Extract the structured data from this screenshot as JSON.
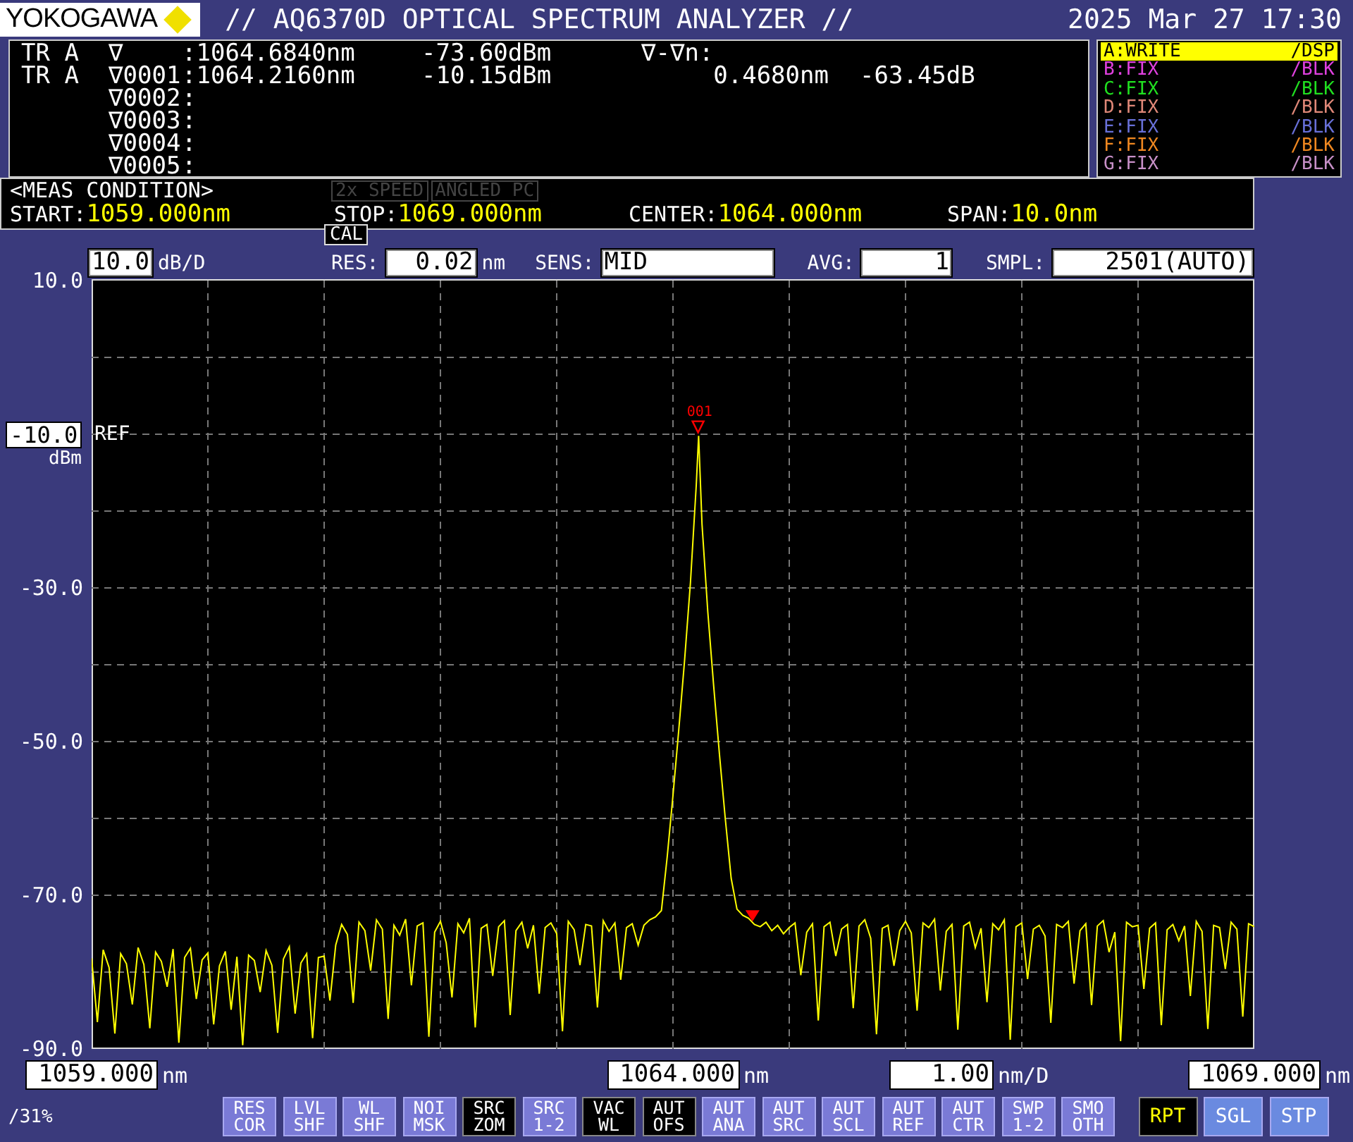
{
  "header": {
    "brand": "YOKOGAWA",
    "title": "// AQ6370D OPTICAL SPECTRUM ANALYZER //",
    "datetime": "2025 Mar 27 17:30"
  },
  "markers": {
    "rows": [
      {
        "trace": "TR A",
        "name": "∇",
        "value": ":1064.6840nm",
        "power": "-73.60dBm"
      },
      {
        "trace": "TR A",
        "name": "∇0001",
        "value": ":1064.2160nm",
        "power": "-10.15dBm"
      },
      {
        "name": "∇0002",
        "value": ":"
      },
      {
        "name": "∇0003",
        "value": ":"
      },
      {
        "name": "∇0004",
        "value": ":"
      },
      {
        "name": "∇0005",
        "value": ":"
      }
    ],
    "delta": {
      "label": "∇-∇n:",
      "wavelength": "0.4680nm",
      "power": "-63.45dB"
    }
  },
  "traces": [
    {
      "label": "A:WRITE",
      "mode": "/DSP",
      "color": "#ffff00",
      "selected": true
    },
    {
      "label": "B:FIX",
      "mode": "/BLK",
      "color": "#e040e0",
      "selected": false
    },
    {
      "label": "C:FIX",
      "mode": "/BLK",
      "color": "#20e020",
      "selected": false
    },
    {
      "label": "D:FIX",
      "mode": "/BLK",
      "color": "#e08878",
      "selected": false
    },
    {
      "label": "E:FIX",
      "mode": "/BLK",
      "color": "#6870d8",
      "selected": false
    },
    {
      "label": "F:FIX",
      "mode": "/BLK",
      "color": "#f08820",
      "selected": false
    },
    {
      "label": "G:FIX",
      "mode": "/BLK",
      "color": "#c890c8",
      "selected": false
    }
  ],
  "meas_condition": {
    "title": "<MEAS CONDITION>",
    "badges": [
      {
        "label": "2x SPEED",
        "on": false
      },
      {
        "label": "ANGLED PC",
        "on": false
      }
    ],
    "params": [
      {
        "label": "START:",
        "value": "1059.000nm"
      },
      {
        "label": "STOP:",
        "value": "1069.000nm"
      },
      {
        "label": "CENTER:",
        "value": "1064.000nm"
      },
      {
        "label": "SPAN:",
        "value": "10.0nm"
      }
    ]
  },
  "settings": {
    "scale": {
      "value": "10.0",
      "unit": "dB/D"
    },
    "cal": "CAL",
    "fields": [
      {
        "label": "RES:",
        "value": "0.02",
        "unit": "nm"
      },
      {
        "label": "SENS:",
        "value": "MID"
      },
      {
        "label": "AVG:",
        "value": "1"
      },
      {
        "label": "SMPL:",
        "value": "2501(AUTO)"
      }
    ]
  },
  "plot": {
    "ref": {
      "value": "-10.0",
      "unit": "dBm",
      "tag": "REF"
    },
    "peak_marker": "001",
    "chart_data": {
      "type": "line",
      "grid": true,
      "xlim": [
        1059,
        1069
      ],
      "ylim": [
        -90,
        10
      ],
      "yticks": [
        {
          "value": 10,
          "label": "10.0"
        },
        {
          "value": -30,
          "label": "-30.0"
        },
        {
          "value": -50,
          "label": "-50.0"
        },
        {
          "value": -70,
          "label": "-70.0"
        },
        {
          "value": -90,
          "label": "-90.0"
        }
      ],
      "xticks": [
        {
          "value": 1059,
          "label": "1059.000"
        },
        {
          "value": 1064,
          "label": "1064.000"
        },
        {
          "value": 1069,
          "label": "1069.000"
        }
      ],
      "x": [
        1059.0,
        1059.05,
        1059.1,
        1059.15,
        1059.2,
        1059.25,
        1059.3,
        1059.35,
        1059.4,
        1059.45,
        1059.5,
        1059.55,
        1059.6,
        1059.65,
        1059.7,
        1059.75,
        1059.8,
        1059.85,
        1059.9,
        1059.95,
        1060.0,
        1060.05,
        1060.1,
        1060.15,
        1060.2,
        1060.25,
        1060.3,
        1060.35,
        1060.4,
        1060.45,
        1060.5,
        1060.55,
        1060.6,
        1060.65,
        1060.7,
        1060.75,
        1060.8,
        1060.85,
        1060.9,
        1060.95,
        1061.0,
        1061.05,
        1061.1,
        1061.15,
        1061.2,
        1061.25,
        1061.3,
        1061.35,
        1061.4,
        1061.45,
        1061.5,
        1061.55,
        1061.6,
        1061.65,
        1061.7,
        1061.75,
        1061.8,
        1061.85,
        1061.9,
        1061.95,
        1062.0,
        1062.05,
        1062.1,
        1062.15,
        1062.2,
        1062.25,
        1062.3,
        1062.35,
        1062.4,
        1062.45,
        1062.5,
        1062.55,
        1062.6,
        1062.65,
        1062.7,
        1062.75,
        1062.8,
        1062.85,
        1062.9,
        1062.95,
        1063.0,
        1063.05,
        1063.1,
        1063.15,
        1063.2,
        1063.25,
        1063.3,
        1063.35,
        1063.4,
        1063.45,
        1063.5,
        1063.55,
        1063.6,
        1063.65,
        1063.7,
        1063.75,
        1063.8,
        1063.85,
        1063.9,
        1063.95,
        1064.0,
        1064.05,
        1064.1,
        1064.15,
        1064.2,
        1064.22,
        1064.25,
        1064.3,
        1064.35,
        1064.4,
        1064.45,
        1064.5,
        1064.55,
        1064.6,
        1064.65,
        1064.7,
        1064.75,
        1064.8,
        1064.85,
        1064.9,
        1064.95,
        1065.0,
        1065.05,
        1065.1,
        1065.15,
        1065.2,
        1065.25,
        1065.3,
        1065.35,
        1065.4,
        1065.45,
        1065.5,
        1065.55,
        1065.6,
        1065.65,
        1065.7,
        1065.75,
        1065.8,
        1065.85,
        1065.9,
        1065.95,
        1066.0,
        1066.05,
        1066.1,
        1066.15,
        1066.2,
        1066.25,
        1066.3,
        1066.35,
        1066.4,
        1066.45,
        1066.5,
        1066.55,
        1066.6,
        1066.65,
        1066.7,
        1066.75,
        1066.8,
        1066.85,
        1066.9,
        1066.95,
        1067.0,
        1067.05,
        1067.1,
        1067.15,
        1067.2,
        1067.25,
        1067.3,
        1067.35,
        1067.4,
        1067.45,
        1067.5,
        1067.55,
        1067.6,
        1067.65,
        1067.7,
        1067.75,
        1067.8,
        1067.85,
        1067.9,
        1067.95,
        1068.0,
        1068.05,
        1068.1,
        1068.15,
        1068.2,
        1068.25,
        1068.3,
        1068.35,
        1068.4,
        1068.45,
        1068.5,
        1068.55,
        1068.6,
        1068.65,
        1068.7,
        1068.75,
        1068.8,
        1068.85,
        1068.9,
        1068.95,
        1069.0
      ],
      "series": [
        {
          "color": "#ffff00",
          "values": [
            -78.2,
            -86.5,
            -77.1,
            -79.4,
            -88.0,
            -77.6,
            -78.9,
            -84.2,
            -76.8,
            -79.0,
            -87.3,
            -77.4,
            -78.6,
            -81.9,
            -77.0,
            -89.2,
            -78.1,
            -76.9,
            -83.5,
            -78.4,
            -77.5,
            -86.8,
            -79.2,
            -77.3,
            -84.9,
            -78.0,
            -89.5,
            -77.8,
            -78.5,
            -82.6,
            -77.2,
            -79.1,
            -87.9,
            -78.3,
            -76.7,
            -85.4,
            -78.8,
            -77.6,
            -88.6,
            -78.1,
            -77.9,
            -83.7,
            -76.5,
            -73.8,
            -75.1,
            -84.0,
            -73.5,
            -74.6,
            -79.8,
            -73.2,
            -74.4,
            -86.1,
            -73.9,
            -75.2,
            -73.1,
            -81.7,
            -74.0,
            -73.6,
            -88.4,
            -74.8,
            -73.4,
            -76.2,
            -83.3,
            -73.7,
            -74.9,
            -73.0,
            -87.2,
            -74.3,
            -73.8,
            -80.5,
            -74.1,
            -73.3,
            -85.6,
            -74.6,
            -73.5,
            -76.9,
            -73.9,
            -82.8,
            -74.2,
            -73.6,
            -75.0,
            -87.7,
            -73.4,
            -74.5,
            -79.1,
            -73.8,
            -74.0,
            -84.6,
            -73.3,
            -74.7,
            -73.6,
            -81.0,
            -74.2,
            -73.7,
            -76.5,
            -73.9,
            -73.2,
            -72.8,
            -72.0,
            -65.0,
            -57.0,
            -48.5,
            -39.5,
            -29.3,
            -16.7,
            -10.2,
            -21.7,
            -33.1,
            -42.8,
            -51.7,
            -60.0,
            -67.8,
            -71.8,
            -72.6,
            -73.0,
            -73.8,
            -74.1,
            -73.5,
            -74.6,
            -73.9,
            -75.0,
            -74.2,
            -73.6,
            -80.4,
            -74.8,
            -73.7,
            -86.3,
            -74.1,
            -73.5,
            -77.9,
            -74.4,
            -73.8,
            -84.7,
            -74.0,
            -73.2,
            -75.6,
            -88.1,
            -74.3,
            -73.9,
            -79.2,
            -74.6,
            -73.4,
            -74.9,
            -85.0,
            -73.6,
            -74.2,
            -73.1,
            -82.4,
            -74.7,
            -73.8,
            -87.5,
            -74.0,
            -73.5,
            -76.8,
            -74.3,
            -83.9,
            -73.7,
            -74.5,
            -73.2,
            -88.8,
            -74.1,
            -73.6,
            -80.9,
            -74.4,
            -73.9,
            -75.3,
            -86.6,
            -73.8,
            -74.2,
            -73.4,
            -81.5,
            -74.6,
            -73.7,
            -84.3,
            -74.0,
            -73.3,
            -77.4,
            -74.8,
            -89.0,
            -73.5,
            -74.1,
            -73.9,
            -82.2,
            -74.3,
            -73.6,
            -86.9,
            -74.5,
            -73.8,
            -75.9,
            -74.0,
            -83.1,
            -73.4,
            -74.7,
            -87.4,
            -73.9,
            -74.2,
            -79.6,
            -73.5,
            -74.4,
            -85.8,
            -73.7,
            -74.1
          ]
        }
      ]
    }
  },
  "x_axis": {
    "tick_units": [
      "nm",
      "nm",
      "nm"
    ],
    "scale": {
      "value": "1.00",
      "unit": "nm/D"
    }
  },
  "status": "/31%",
  "softkeys": [
    {
      "label": "RES\nCOR",
      "kind": "function",
      "selected": false
    },
    {
      "label": "LVL\nSHF",
      "kind": "function",
      "selected": false
    },
    {
      "label": "WL\nSHF",
      "kind": "function",
      "selected": false
    },
    {
      "label": "NOI\nMSK",
      "kind": "function",
      "selected": false
    },
    {
      "label": "SRC\nZOM",
      "kind": "function",
      "selected": true
    },
    {
      "label": "SRC\n1-2",
      "kind": "function",
      "selected": false
    },
    {
      "label": "VAC\nWL",
      "kind": "function",
      "selected": true
    },
    {
      "label": "AUT\nOFS",
      "kind": "function",
      "selected": true
    },
    {
      "label": "AUT\nANA",
      "kind": "function",
      "selected": false
    },
    {
      "label": "AUT\nSRC",
      "kind": "function",
      "selected": false
    },
    {
      "label": "AUT\nSCL",
      "kind": "function",
      "selected": false
    },
    {
      "label": "AUT\nREF",
      "kind": "function",
      "selected": false
    },
    {
      "label": "AUT\nCTR",
      "kind": "function",
      "selected": false
    },
    {
      "label": "SWP\n1-2",
      "kind": "function",
      "selected": false
    },
    {
      "label": "SMO\nOTH",
      "kind": "function",
      "selected": false
    },
    {
      "label": "RPT",
      "kind": "mode",
      "selected": true
    },
    {
      "label": "SGL",
      "kind": "mode",
      "selected": false
    },
    {
      "label": "STP",
      "kind": "mode",
      "selected": false
    }
  ]
}
